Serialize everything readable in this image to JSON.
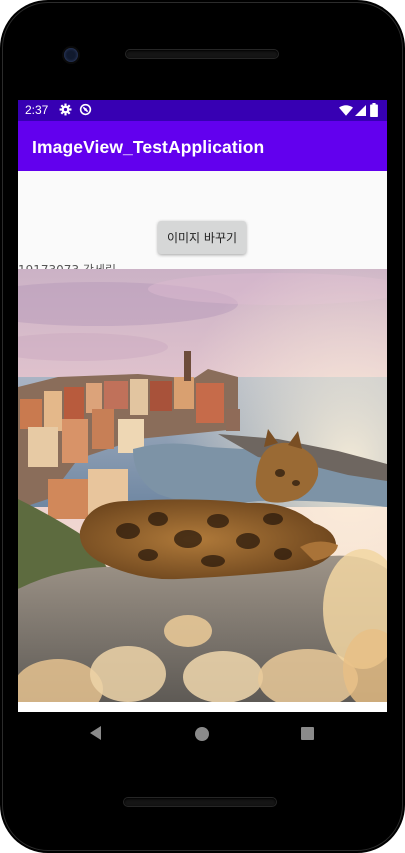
{
  "status_bar": {
    "time": "2:37",
    "background": "#3700b3",
    "icons": [
      "gear-icon",
      "sync-icon",
      "wifi-icon",
      "signal-icon",
      "battery-icon"
    ]
  },
  "app_bar": {
    "title": "ImageView_TestApplication",
    "background": "#6200ee"
  },
  "content": {
    "button_label": "이미지 바꾸기",
    "student_text": "19173073 강세림",
    "image": "cat-on-rock-over-coastal-village"
  },
  "nav_bar": {
    "icons": [
      "back-icon",
      "home-icon",
      "recent-apps-icon"
    ]
  }
}
